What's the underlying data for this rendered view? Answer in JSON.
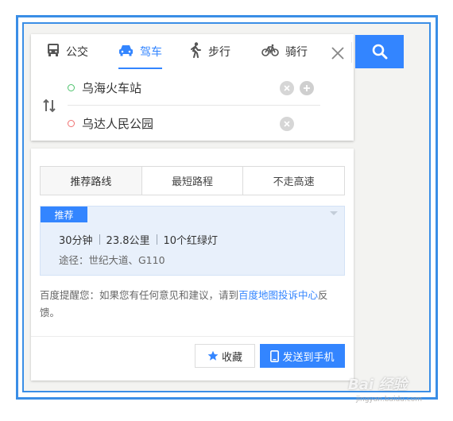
{
  "transport_tabs": [
    {
      "label": "公交",
      "icon": "bus-icon",
      "active": false
    },
    {
      "label": "驾车",
      "icon": "car-icon",
      "active": true
    },
    {
      "label": "步行",
      "icon": "walk-icon",
      "active": false
    },
    {
      "label": "骑行",
      "icon": "bike-icon",
      "active": false
    }
  ],
  "route": {
    "from": "乌海火车站",
    "to": "乌达人民公园"
  },
  "strategy_tabs": [
    {
      "label": "推荐路线",
      "active": true
    },
    {
      "label": "最短路程",
      "active": false
    },
    {
      "label": "不走高速",
      "active": false
    }
  ],
  "result": {
    "badge": "推荐",
    "duration": "30分钟",
    "distance": "23.8公里",
    "lights": "10个红绿灯",
    "via": "途径：世纪大道、G110"
  },
  "notice": {
    "prefix": "百度提醒您：如果您有任何意见和建议，请到",
    "link": "百度地图投诉中心",
    "suffix": "反馈。"
  },
  "actions": {
    "favorite": "收藏",
    "send": "发送到手机"
  },
  "watermark": {
    "main": "Bai 经验",
    "sub": "jingyan.baidu.com"
  },
  "colors": {
    "accent": "#3385ff",
    "frame": "#3a8ee6"
  }
}
